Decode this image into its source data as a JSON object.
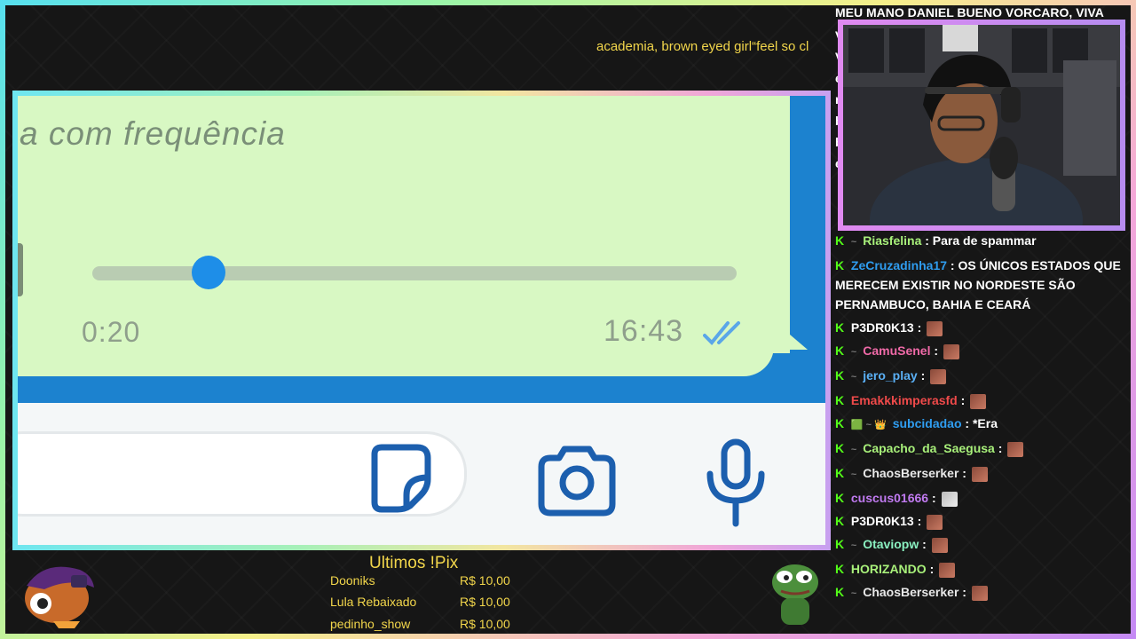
{
  "ticker": {
    "text": "academia, brown eyed girl“feel so cl"
  },
  "video": {
    "message_text": "a com frequência",
    "audio": {
      "elapsed": "0:20",
      "timestamp": "16:43",
      "progress": 0.18
    }
  },
  "chat": {
    "top_message": "MEU MANO DANIEL BUENO VORCARO, VIVA",
    "top_strip": [
      "V",
      "V",
      "e",
      "n",
      "b",
      "b",
      "e"
    ],
    "platform_icon": "K",
    "messages": [
      {
        "user": "Riasfelina",
        "color": "#a8f07a",
        "text": ": Para de spammar",
        "badge": "~",
        "emote": ""
      },
      {
        "user": "ZeCruzadinha17",
        "color": "#2f9df0",
        "text": ": OS ÚNICOS ESTADOS QUE MERECEM EXISTIR NO NORDESTE SÃO PERNAMBUCO, BAHIA E CEARÁ",
        "badge": "",
        "emote": ""
      },
      {
        "user": "P3DR0K13",
        "color": "#ffffff",
        "text": " :",
        "badge": "",
        "emote": "pepe"
      },
      {
        "user": "CamuSenel",
        "color": "#f06aa8",
        "text": " :",
        "badge": "~",
        "emote": "pepe"
      },
      {
        "user": "jero_play",
        "color": "#5ab0f5",
        "text": " :",
        "badge": "~",
        "emote": "pepe"
      },
      {
        "user": "Emakkkimperasfd",
        "color": "#f04a4a",
        "text": " :",
        "badge": "",
        "emote": "pepe"
      },
      {
        "user": "subcidadao",
        "color": "#2f9df0",
        "text": " : *Era",
        "badge": "🟩 ~ 👑",
        "emote": ""
      },
      {
        "user": "Capacho_da_Saegusa",
        "color": "#a8f07a",
        "text": " :",
        "badge": "~",
        "emote": "pepe"
      },
      {
        "user": "ChaosBerserker",
        "color": "#e8e8e8",
        "text": " :",
        "badge": "~",
        "emote": "pepe"
      },
      {
        "user": "cuscus01666",
        "color": "#c07af0",
        "text": " :",
        "badge": "",
        "emote": "dog"
      },
      {
        "user": "P3DR0K13",
        "color": "#ffffff",
        "text": " :",
        "badge": "",
        "emote": "pepe"
      },
      {
        "user": "Otaviopw",
        "color": "#8af0c0",
        "text": " :",
        "badge": "~",
        "emote": "pepe"
      },
      {
        "user": "HORIZANDO",
        "color": "#a8f07a",
        "text": " :",
        "badge": "",
        "emote": "pepe"
      },
      {
        "user": "ChaosBerserker",
        "color": "#e8e8e8",
        "text": " :",
        "badge": "~",
        "emote": "pepe"
      }
    ]
  },
  "pix": {
    "title": "Ultimos !Pix",
    "rows": [
      {
        "name": "Dooniks",
        "value": "R$ 10,00"
      },
      {
        "name": "Lula Rebaixado",
        "value": "R$ 10,00"
      },
      {
        "name": "pedinho_show",
        "value": "R$ 10,00"
      }
    ]
  },
  "colors": {
    "accent_yellow": "#f2d64b",
    "kick_green": "#53fc18",
    "bubble": "#d8f8c3",
    "whatsapp_blue": "#1e8ee8"
  }
}
